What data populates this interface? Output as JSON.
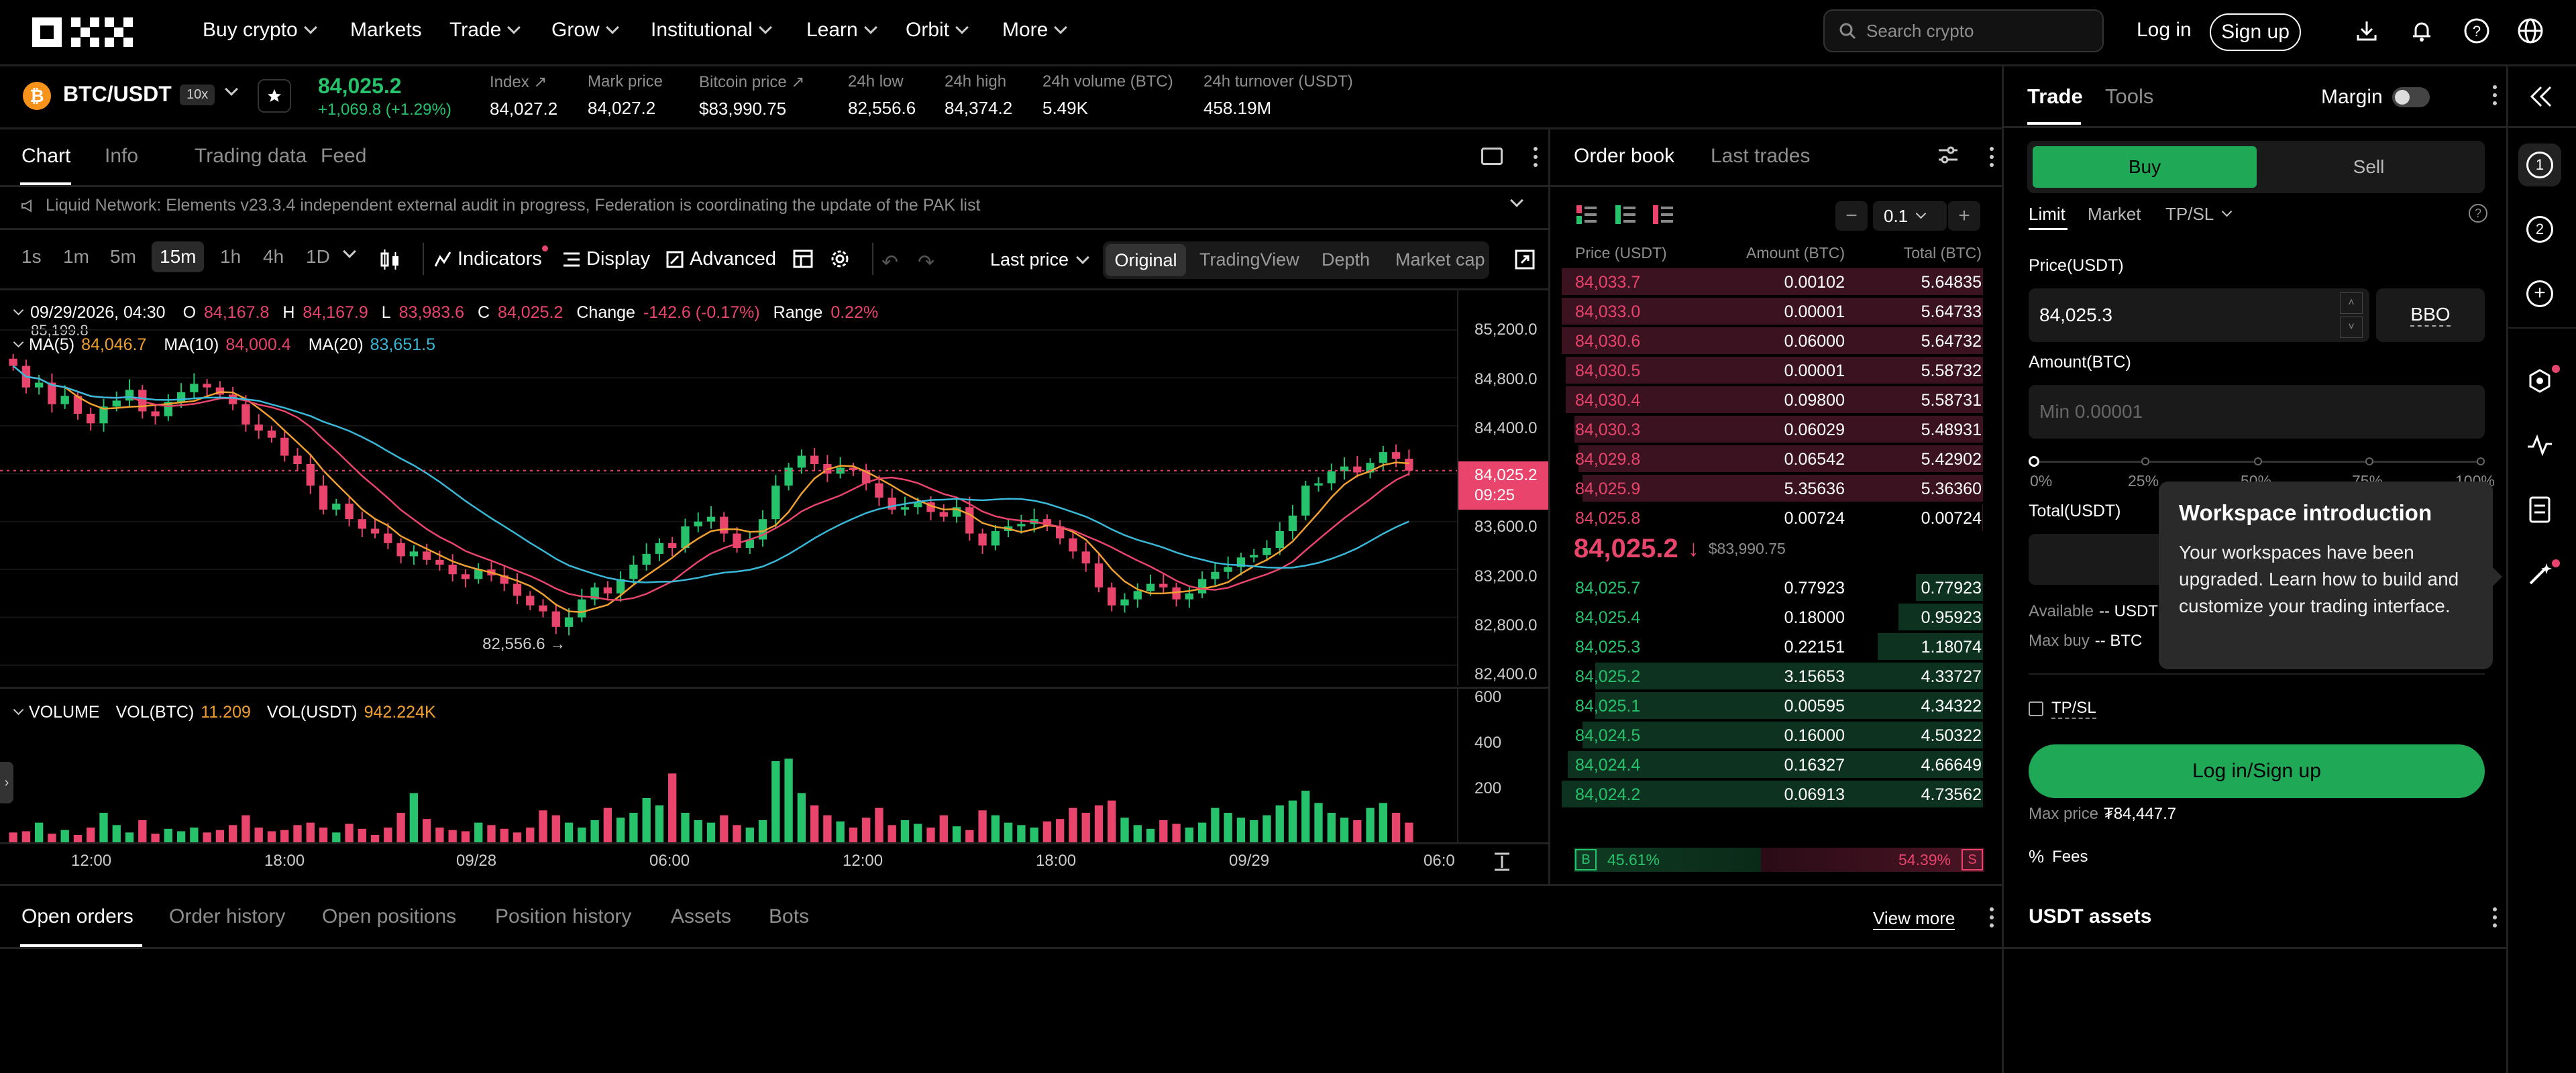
{
  "nav": {
    "items": [
      {
        "label": "Buy crypto",
        "chev": true
      },
      {
        "label": "Markets",
        "chev": false
      },
      {
        "label": "Trade",
        "chev": true
      },
      {
        "label": "Grow",
        "chev": true
      },
      {
        "label": "Institutional",
        "chev": true
      },
      {
        "label": "Learn",
        "chev": true
      },
      {
        "label": "Orbit",
        "chev": true
      },
      {
        "label": "More",
        "chev": true
      }
    ],
    "search_placeholder": "Search crypto",
    "login": "Log in",
    "signup": "Sign up"
  },
  "ticker": {
    "pair": "BTC/USDT",
    "leverage": "10x",
    "price": "84,025.2",
    "change": "+1,069.8 (+1.29%)",
    "stats": [
      {
        "label": "Index",
        "value": "84,027.2",
        "link": true
      },
      {
        "label": "Mark price",
        "value": "84,027.2",
        "link": false
      },
      {
        "label": "Bitcoin price",
        "value": "$83,990.75",
        "link": true
      },
      {
        "label": "24h low",
        "value": "82,556.6",
        "link": false
      },
      {
        "label": "24h high",
        "value": "84,374.2",
        "link": false
      },
      {
        "label": "24h volume (BTC)",
        "value": "5.49K",
        "link": false
      },
      {
        "label": "24h turnover (USDT)",
        "value": "458.19M",
        "link": false
      }
    ]
  },
  "chart_panel": {
    "tabs": [
      "Chart",
      "Info",
      "Trading data",
      "Feed"
    ],
    "notice": "Liquid Network: Elements v23.3.4 independent external audit in progress, Federation is coordinating the update of the PAK list",
    "timeframes": [
      "1s",
      "1m",
      "5m",
      "15m",
      "1h",
      "4h",
      "1D"
    ],
    "active_timeframe": "15m",
    "tools": {
      "indicators": "Indicators",
      "display": "Display",
      "advanced": "Advanced",
      "last_price": "Last price"
    },
    "views": [
      "Original",
      "TradingView",
      "Depth",
      "Market cap"
    ]
  },
  "chart_data": {
    "type": "candlestick",
    "ohlc_header": {
      "datetime": "09/29/2026, 04:30",
      "O": "84,167.8",
      "H": "84,167.9",
      "L": "83,983.6",
      "C": "84,025.2",
      "change_label": "Change",
      "change": "-142.6 (-0.17%)",
      "range_label": "Range",
      "range": "0.22%"
    },
    "ma_labels": [
      {
        "name": "MA(5)",
        "value": "84,046.7",
        "color": "#f0a030"
      },
      {
        "name": "MA(10)",
        "value": "84,000.4",
        "color": "#e8446c"
      },
      {
        "name": "MA(20)",
        "value": "83,651.5",
        "color": "#3ab8d8"
      }
    ],
    "high_marker": "85,199.8",
    "low_marker": "82,556.6 →",
    "price_axis": [
      "85,200.0",
      "84,800.0",
      "84,400.0",
      "84,000.0",
      "83,600.0",
      "83,200.0",
      "82,800.0",
      "82,400.0"
    ],
    "ylim": [
      82400,
      85200
    ],
    "current_price_tag": "84,025.2",
    "current_time_tag": "09:25",
    "time_axis": [
      "12:00",
      "18:00",
      "09/28",
      "06:00",
      "12:00",
      "18:00",
      "09/29",
      "06:0"
    ],
    "volume_header": {
      "label": "VOLUME",
      "vol_btc_label": "VOL(BTC)",
      "vol_btc": "11.209",
      "vol_usdt_label": "VOL(USDT)",
      "vol_usdt": "942.224K"
    },
    "volume_axis": [
      "600",
      "400",
      "200"
    ],
    "closes": [
      84900,
      84720,
      84760,
      84580,
      84650,
      84500,
      84420,
      84560,
      84610,
      84700,
      84520,
      84480,
      84600,
      84680,
      84750,
      84720,
      84660,
      84580,
      84410,
      84360,
      84300,
      84150,
      84080,
      83900,
      83700,
      83750,
      83620,
      83540,
      83500,
      83420,
      83310,
      83350,
      83280,
      83240,
      83160,
      83120,
      83200,
      83150,
      83080,
      82980,
      82900,
      82850,
      82720,
      82800,
      82950,
      83050,
      83000,
      83120,
      83240,
      83330,
      83420,
      83380,
      83560,
      83600,
      83640,
      83500,
      83380,
      83450,
      83620,
      83900,
      84050,
      84150,
      84080,
      84000,
      84050,
      84030,
      83920,
      83800,
      83700,
      83720,
      83760,
      83680,
      83640,
      83720,
      83500,
      83400,
      83520,
      83560,
      83580,
      83620,
      83560,
      83460,
      83350,
      83250,
      83050,
      82900,
      82950,
      83020,
      83080,
      83050,
      82950,
      83000,
      83120,
      83180,
      83220,
      83300,
      83320,
      83380,
      83520,
      83650,
      83900,
      83920,
      84020,
      84060,
      84010,
      84090,
      84180,
      84125,
      84025
    ],
    "volumes": [
      40,
      45,
      80,
      35,
      50,
      30,
      60,
      120,
      70,
      40,
      90,
      35,
      55,
      45,
      60,
      40,
      50,
      70,
      110,
      60,
      45,
      50,
      70,
      80,
      60,
      40,
      75,
      55,
      30,
      60,
      120,
      200,
      95,
      60,
      50,
      45,
      80,
      70,
      55,
      40,
      60,
      130,
      110,
      80,
      60,
      90,
      140,
      100,
      120,
      180,
      150,
      280,
      120,
      90,
      80,
      110,
      70,
      60,
      90,
      330,
      340,
      200,
      150,
      110,
      85,
      60,
      100,
      140,
      70,
      90,
      75,
      60,
      110,
      65,
      50,
      130,
      110,
      80,
      70,
      60,
      85,
      95,
      140,
      120,
      150,
      170,
      100,
      70,
      55,
      90,
      75,
      60,
      80,
      140,
      120,
      100,
      90,
      110,
      150,
      170,
      210,
      160,
      120,
      100,
      90,
      140,
      160,
      120,
      80
    ]
  },
  "order_book": {
    "tabs": [
      "Order book",
      "Last trades"
    ],
    "step": "0.1",
    "headers": [
      "Price (USDT)",
      "Amount (BTC)",
      "Total (BTC)"
    ],
    "asks": [
      [
        "84,033.7",
        "0.00102",
        "5.64835"
      ],
      [
        "84,033.0",
        "0.00001",
        "5.64733"
      ],
      [
        "84,030.6",
        "0.06000",
        "5.64732"
      ],
      [
        "84,030.5",
        "0.00001",
        "5.58732"
      ],
      [
        "84,030.4",
        "0.09800",
        "5.58731"
      ],
      [
        "84,030.3",
        "0.06029",
        "5.48931"
      ],
      [
        "84,029.8",
        "0.06542",
        "5.42902"
      ],
      [
        "84,025.9",
        "5.35636",
        "5.36360"
      ],
      [
        "84,025.8",
        "0.00724",
        "0.00724"
      ]
    ],
    "ask_depth": [
      1.0,
      1.0,
      1.0,
      0.99,
      0.99,
      0.97,
      0.96,
      0.95,
      0.0013
    ],
    "mid_price": "84,025.2",
    "mid_ref": "$83,990.75",
    "bids": [
      [
        "84,025.7",
        "0.77923",
        "0.77923"
      ],
      [
        "84,025.4",
        "0.18000",
        "0.95923"
      ],
      [
        "84,025.3",
        "0.22151",
        "1.18074"
      ],
      [
        "84,025.2",
        "3.15653",
        "4.33727"
      ],
      [
        "84,025.1",
        "0.00595",
        "4.34322"
      ],
      [
        "84,024.5",
        "0.16000",
        "4.50322"
      ],
      [
        "84,024.4",
        "0.16327",
        "4.66649"
      ],
      [
        "84,024.2",
        "0.06913",
        "4.73562"
      ]
    ],
    "bid_depth": [
      0.16,
      0.2,
      0.25,
      0.92,
      0.92,
      0.95,
      0.985,
      1.0
    ],
    "buy_ratio": "45.61%",
    "sell_ratio": "54.39%",
    "buy_letter": "B",
    "sell_letter": "S"
  },
  "trade_panel": {
    "tabs": [
      "Trade",
      "Tools"
    ],
    "margin_label": "Margin",
    "buy": "Buy",
    "sell": "Sell",
    "order_types": [
      "Limit",
      "Market",
      "TP/SL"
    ],
    "price_label": "Price(USDT)",
    "price_value": "84,025.3",
    "bbo": "BBO",
    "amount_label": "Amount(BTC)",
    "amount_placeholder": "Min 0.00001",
    "slider_labels": [
      "0%",
      "25%",
      "50%",
      "75%",
      "100%"
    ],
    "total_label": "Total(USDT)",
    "available_label": "Available",
    "available_value": "-- USDT",
    "max_buy_label": "Max buy",
    "max_buy_value": "-- BTC",
    "tpsl_label": "TP/SL",
    "login_button": "Log in/Sign up",
    "max_price_label": "Max price",
    "max_price_value": "₮84,447.7",
    "fees_label": "Fees"
  },
  "tooltip": {
    "title": "Workspace introduction",
    "body": "Your workspaces have been upgraded. Learn how to build and customize your trading interface."
  },
  "bottom": {
    "tabs": [
      "Open orders",
      "Order history",
      "Open positions",
      "Position history",
      "Assets",
      "Bots"
    ],
    "view_more": "View more",
    "assets_title": "USDT assets"
  },
  "sidebar": {
    "badges": [
      "1",
      "2"
    ]
  },
  "colors": {
    "up": "#27c26c",
    "down": "#e8446c",
    "ma5": "#f0a030",
    "ma10": "#e8446c",
    "ma20": "#3ab8d8",
    "buy_button": "#1fa855",
    "cta": "#1fa855"
  }
}
